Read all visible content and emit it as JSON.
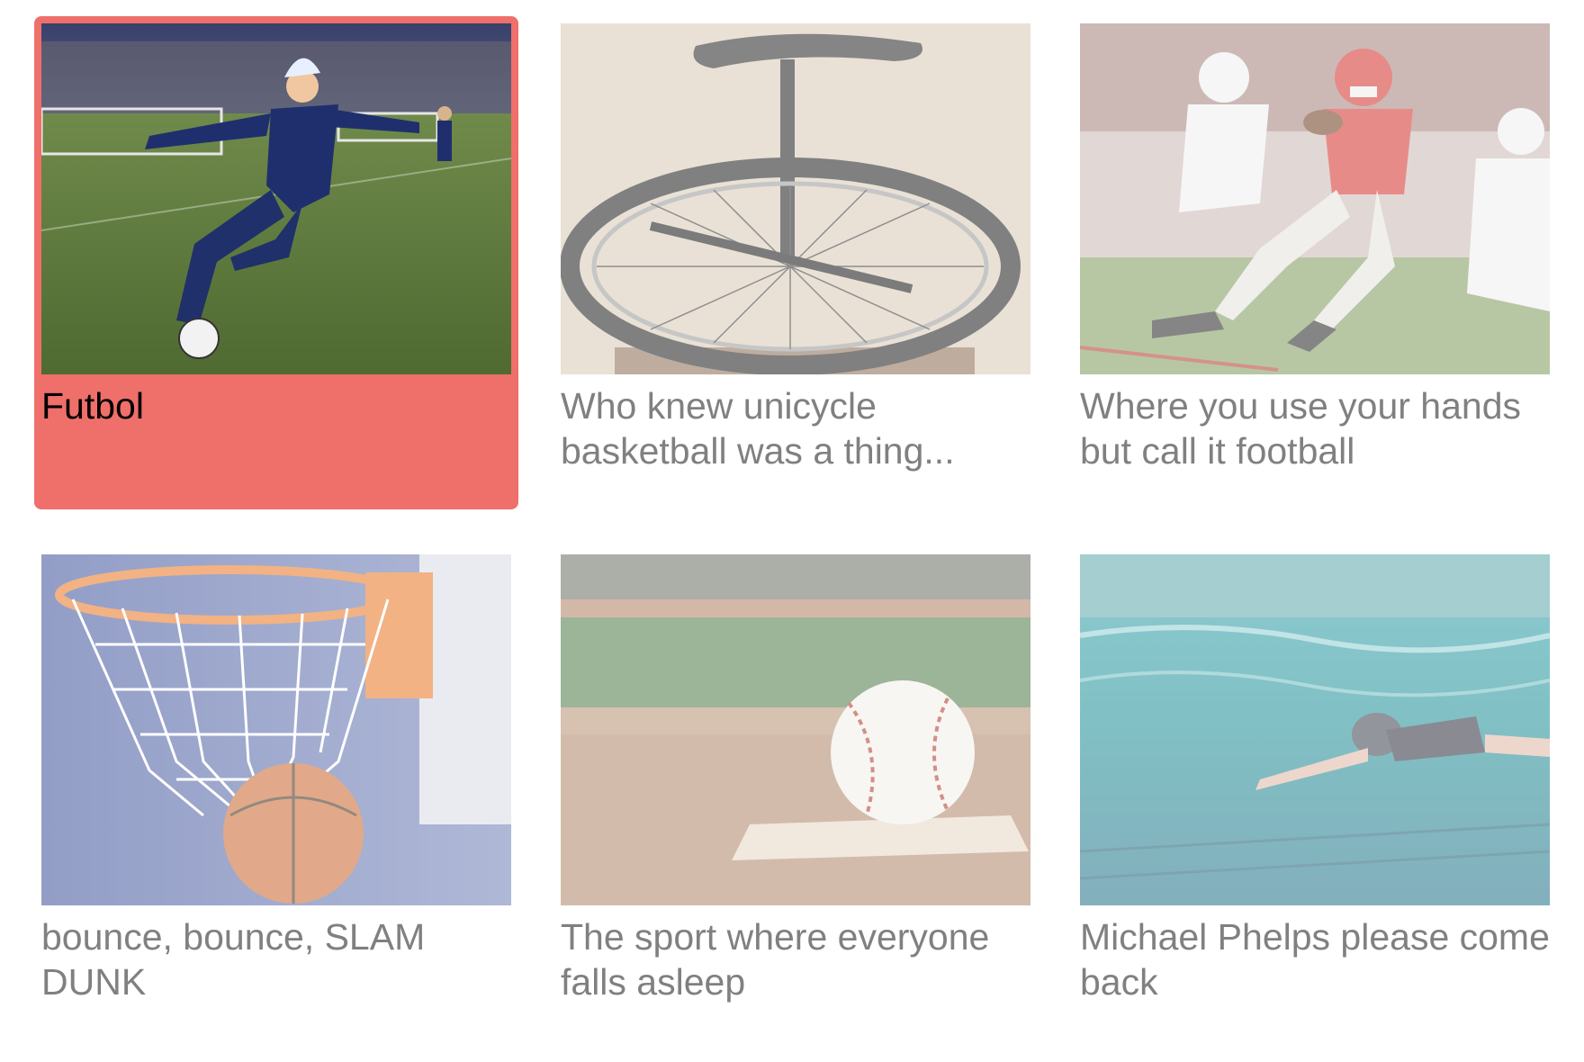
{
  "accent_color": "#ef6f6a",
  "muted_text_color": "#808080",
  "selected_index": 0,
  "cards": [
    {
      "caption": "Futbol",
      "image": "soccer-player-kicking-ball",
      "selected": true
    },
    {
      "caption": "Who knew unicycle basketball was a thing...",
      "image": "unicycle",
      "selected": false
    },
    {
      "caption": "Where you use your hands but call it football",
      "image": "american-football-runner",
      "selected": false
    },
    {
      "caption": "bounce, bounce, SLAM DUNK",
      "image": "basketball-hoop-net",
      "selected": false
    },
    {
      "caption": "The sport where everyone falls asleep",
      "image": "baseball-on-mound",
      "selected": false
    },
    {
      "caption": "Michael Phelps please come back",
      "image": "underwater-swimmer",
      "selected": false
    }
  ]
}
